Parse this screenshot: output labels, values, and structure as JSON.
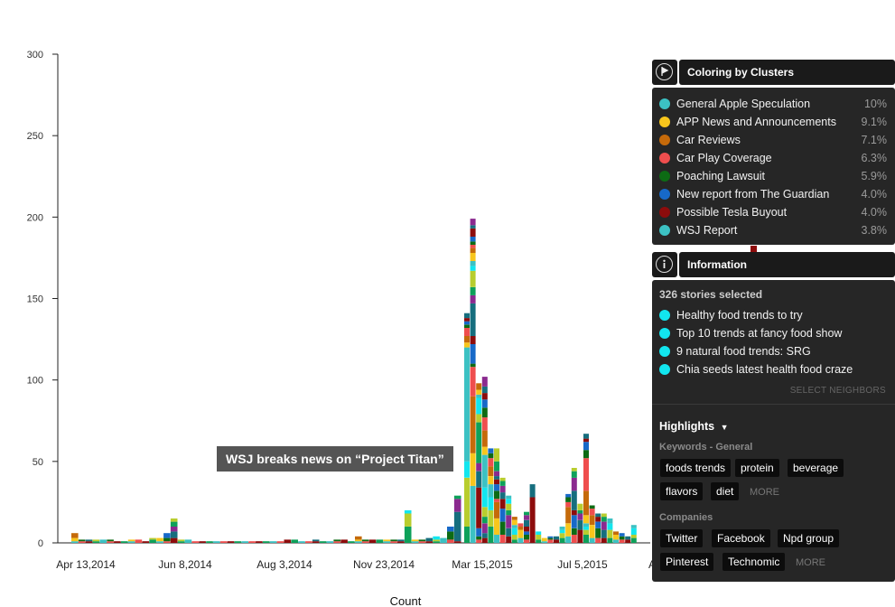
{
  "chart_data": {
    "type": "bar",
    "stacked": true,
    "ylim": [
      0,
      300
    ],
    "yticks": [
      0,
      50,
      100,
      150,
      200,
      250,
      300
    ],
    "xtick_labels": [
      "Apr 13,2014",
      "Jun 8,2014",
      "Aug 3,2014",
      "Nov 23,2014",
      "Mar 15,2015",
      "Jul 5,2015",
      "A"
    ],
    "xlabel": "Count",
    "annotation": "WSJ breaks news on “Project Titan”",
    "bars": [
      {
        "segments": [
          1,
          2,
          3
        ]
      },
      {
        "segments": [
          1,
          1
        ]
      },
      {
        "segments": [
          1,
          1
        ]
      },
      {
        "segments": [
          1,
          1
        ]
      },
      {
        "segments": [
          2
        ]
      },
      {
        "segments": [
          1,
          1
        ]
      },
      {
        "segments": [
          1
        ]
      },
      {
        "segments": [
          1
        ]
      },
      {
        "segments": [
          1,
          1
        ]
      },
      {
        "segments": [
          2
        ]
      },
      {
        "segments": [
          1
        ]
      },
      {
        "segments": [
          2,
          1
        ]
      },
      {
        "segments": [
          1,
          2
        ]
      },
      {
        "segments": [
          1,
          2,
          3
        ]
      },
      {
        "segments": [
          3,
          4,
          3,
          3,
          2
        ]
      },
      {
        "segments": [
          1,
          1
        ]
      },
      {
        "segments": [
          2
        ]
      },
      {
        "segments": [
          1
        ]
      },
      {
        "segments": [
          1
        ]
      },
      {
        "segments": [
          1
        ]
      },
      {
        "segments": [
          1
        ]
      },
      {
        "segments": [
          1
        ]
      },
      {
        "segments": [
          1
        ]
      },
      {
        "segments": [
          1
        ]
      },
      {
        "segments": [
          1
        ]
      },
      {
        "segments": [
          1
        ]
      },
      {
        "segments": [
          1
        ]
      },
      {
        "segments": [
          1
        ]
      },
      {
        "segments": [
          1
        ]
      },
      {
        "segments": [
          1
        ]
      },
      {
        "segments": [
          2
        ]
      },
      {
        "segments": [
          2
        ]
      },
      {
        "segments": [
          1
        ]
      },
      {
        "segments": [
          1
        ]
      },
      {
        "segments": [
          1,
          1
        ]
      },
      {
        "segments": [
          1
        ]
      },
      {
        "segments": [
          1
        ]
      },
      {
        "segments": [
          1,
          1
        ]
      },
      {
        "segments": [
          2
        ]
      },
      {
        "segments": [
          1
        ]
      },
      {
        "segments": [
          1,
          1,
          2
        ]
      },
      {
        "segments": [
          1,
          1
        ]
      },
      {
        "segments": [
          2
        ]
      },
      {
        "segments": [
          2
        ]
      },
      {
        "segments": [
          1,
          1
        ]
      },
      {
        "segments": [
          1,
          1
        ]
      },
      {
        "segments": [
          1,
          1
        ]
      },
      {
        "segments": [
          10,
          8,
          2
        ]
      },
      {
        "segments": [
          1,
          1
        ]
      },
      {
        "segments": [
          1,
          1
        ]
      },
      {
        "segments": [
          1,
          2
        ]
      },
      {
        "segments": [
          1,
          1,
          2
        ]
      },
      {
        "segments": [
          3
        ]
      },
      {
        "segments": [
          2,
          5,
          3
        ]
      },
      {
        "segments": [
          1,
          18,
          8,
          2
        ]
      },
      {
        "segments": [
          10,
          30,
          10,
          70,
          3,
          4,
          5,
          2,
          2,
          2,
          3
        ]
      },
      {
        "segments": [
          35,
          20,
          35,
          18,
          2,
          12,
          5,
          20,
          5,
          5,
          10,
          3,
          3,
          5,
          3,
          2,
          2,
          3,
          5,
          2,
          4
        ]
      },
      {
        "segments": [
          2,
          2,
          5,
          25,
          10,
          5,
          25,
          5,
          10,
          2,
          3,
          4
        ]
      },
      {
        "segments": [
          3,
          3,
          6,
          4,
          6,
          12,
          20,
          5,
          10,
          8,
          6,
          5,
          4,
          4,
          6
        ]
      },
      {
        "segments": [
          10,
          10,
          8,
          8,
          5,
          6,
          5,
          3,
          3
        ]
      },
      {
        "segments": [
          5,
          10,
          10,
          2,
          5,
          4,
          3,
          2,
          3,
          6,
          8
        ]
      },
      {
        "segments": [
          5,
          8,
          8,
          6,
          4,
          4,
          3,
          2
        ]
      },
      {
        "segments": [
          4,
          5,
          8,
          3,
          4,
          3,
          2
        ]
      },
      {
        "segments": [
          2,
          3,
          4,
          2,
          3,
          2
        ]
      },
      {
        "segments": [
          3,
          5,
          2,
          2
        ]
      },
      {
        "segments": [
          2,
          3,
          2,
          3,
          4,
          3,
          2
        ]
      },
      {
        "segments": [
          28,
          8
        ]
      },
      {
        "segments": [
          2,
          3,
          2
        ]
      },
      {
        "segments": [
          1,
          2
        ]
      },
      {
        "segments": [
          2,
          1,
          1
        ]
      },
      {
        "segments": [
          2,
          2
        ]
      },
      {
        "segments": [
          3,
          3,
          2,
          2
        ]
      },
      {
        "segments": [
          4,
          8,
          10,
          3,
          3,
          2
        ]
      },
      {
        "segments": [
          5,
          4,
          8,
          3,
          12,
          8,
          4,
          2
        ]
      },
      {
        "segments": [
          8,
          6,
          4,
          2,
          4
        ]
      },
      {
        "segments": [
          5,
          3,
          2,
          2,
          5,
          15,
          20,
          5,
          5,
          2,
          3
        ]
      },
      {
        "segments": [
          3,
          8,
          6,
          4,
          2
        ]
      },
      {
        "segments": [
          3,
          6,
          4,
          3,
          2
        ]
      },
      {
        "segments": [
          3,
          5,
          5,
          3,
          2
        ]
      },
      {
        "segments": [
          3,
          5,
          4,
          3
        ]
      },
      {
        "segments": [
          2,
          3,
          2
        ]
      },
      {
        "segments": [
          2,
          2,
          2
        ]
      },
      {
        "segments": [
          2,
          2
        ]
      },
      {
        "segments": [
          3,
          2,
          4,
          2
        ]
      }
    ]
  },
  "colors": {
    "teal": "#3cc1c3",
    "yellow": "#f8c61c",
    "orange": "#c56a0a",
    "red": "#ef4e4e",
    "green": "#0d6b14",
    "blue": "#1769c8",
    "maroon": "#8d0c0c",
    "darkteal": "#166e7e",
    "purple": "#8b2a8f",
    "palegreen": "#0ea15a",
    "lime": "#b8cd2e",
    "cyan": "#12e6ef"
  },
  "clusters_panel": {
    "title": "Coloring by Clusters",
    "icon": "flag-icon",
    "items": [
      {
        "name": "General Apple Speculation",
        "pct": "10%",
        "color": "#3cc1c3"
      },
      {
        "name": "APP News and Announcements",
        "pct": "9.1%",
        "color": "#f8c61c"
      },
      {
        "name": "Car Reviews",
        "pct": "7.1%",
        "color": "#c56a0a"
      },
      {
        "name": "Car Play Coverage",
        "pct": "6.3%",
        "color": "#ef4e4e"
      },
      {
        "name": "Poaching Lawsuit",
        "pct": "5.9%",
        "color": "#0d6b14"
      },
      {
        "name": "New report from The Guardian",
        "pct": "4.0%",
        "color": "#1769c8"
      },
      {
        "name": "Possible Tesla Buyout",
        "pct": "4.0%",
        "color": "#8d0c0c"
      },
      {
        "name": "WSJ Report",
        "pct": "3.8%",
        "color": "#3cc1c3"
      }
    ]
  },
  "info_panel": {
    "title": "Information",
    "icon": "info-icon",
    "selected_count": "326 stories selected",
    "stories": [
      "Healthy food trends to try",
      "Top 10 trends at fancy food show",
      "9 natural food trends: SRG",
      "Chia seeds latest health food craze"
    ],
    "select_neighbors": "SELECT NEIGHBORS",
    "highlights_label": "Highlights",
    "keywords_label": "Keywords - General",
    "keywords": [
      "foods trends",
      "protein",
      "beverage",
      "flavors",
      "diet"
    ],
    "keywords_more": "MORE",
    "companies_label": "Companies",
    "companies": [
      "Twitter",
      "Facebook",
      "Npd group",
      "Pinterest",
      "Technomic"
    ],
    "companies_more": "MORE"
  }
}
